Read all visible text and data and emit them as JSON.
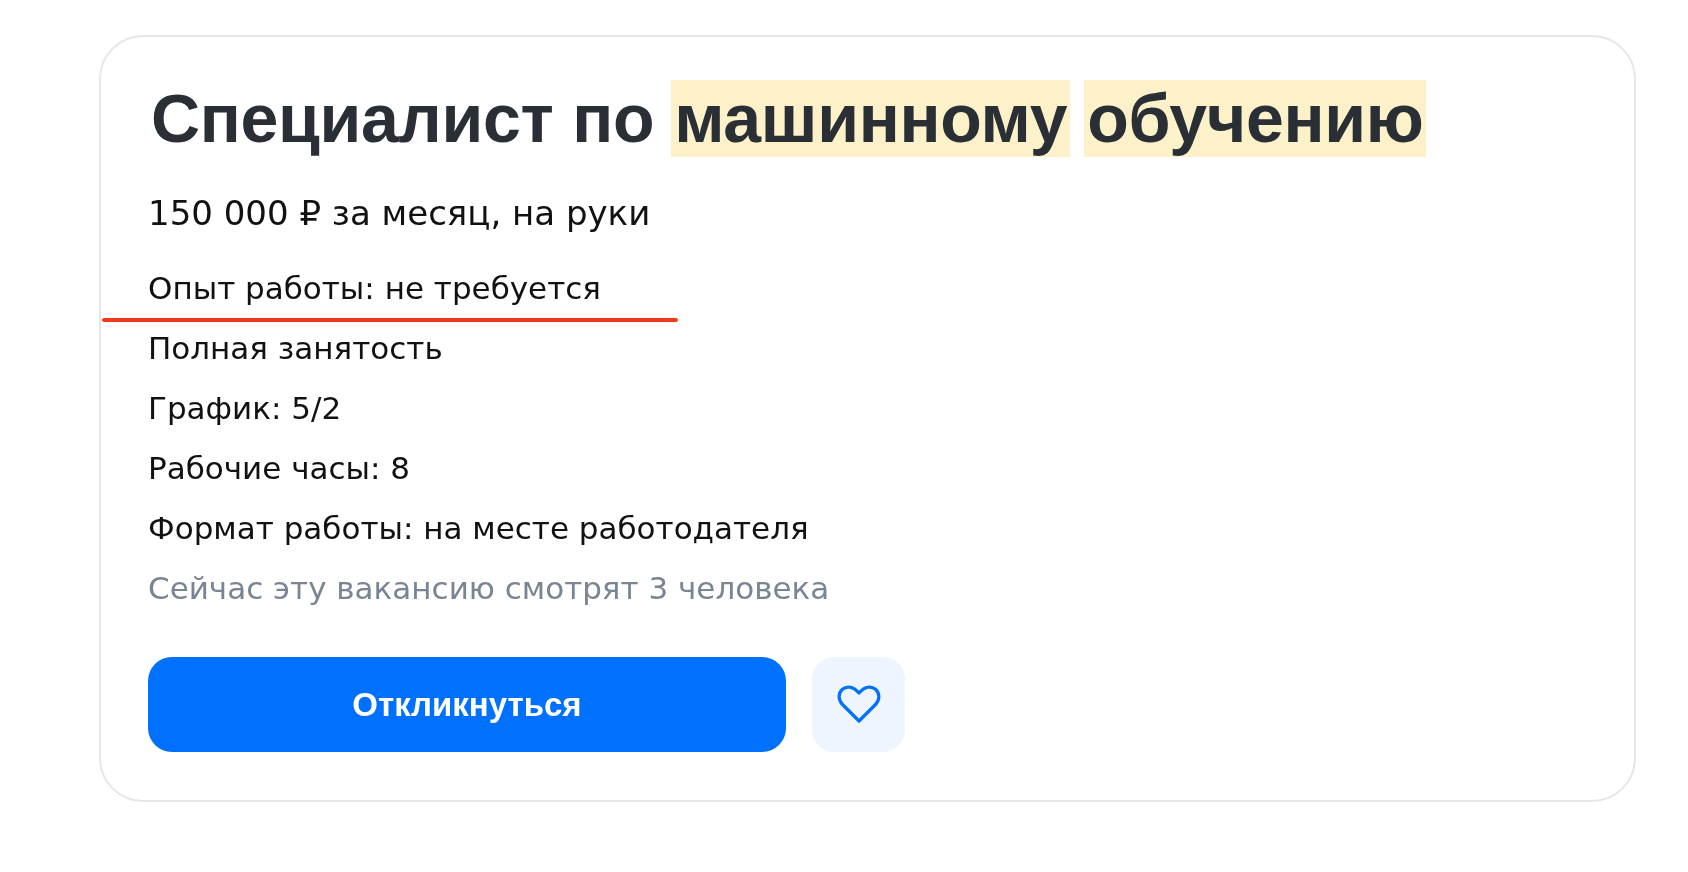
{
  "vacancy": {
    "title": [
      {
        "text": "Специалист по",
        "highlighted": false
      },
      {
        "text": "машинному",
        "highlighted": true
      },
      {
        "text": "обучению",
        "highlighted": true
      }
    ],
    "salary": "150 000 ₽ за месяц, на руки",
    "details": [
      {
        "text": "Опыт работы: не требуется",
        "underlined": true
      },
      {
        "text": "Полная занятость",
        "underlined": false
      },
      {
        "text": "График: 5/2",
        "underlined": false
      },
      {
        "text": "Рабочие часы: 8",
        "underlined": false
      },
      {
        "text": "Формат работы: на месте работодателя",
        "underlined": false
      }
    ],
    "viewers": "Сейчас эту вакансию смотрят 3 человека",
    "apply_button": "Откликнуться",
    "favorited": false
  }
}
